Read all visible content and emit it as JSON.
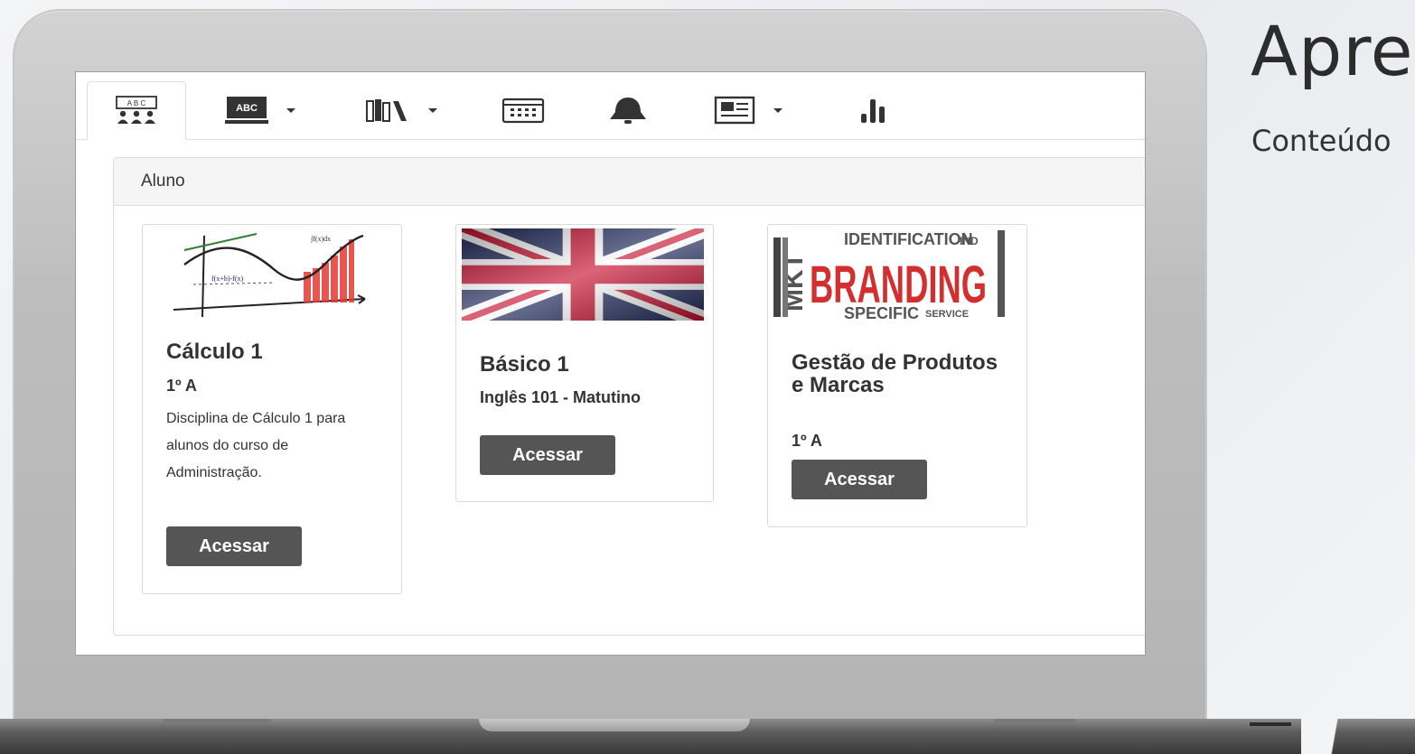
{
  "aside": {
    "title": "Apre",
    "subtitle": "Conteúdo"
  },
  "tabs": [
    {
      "icon": "class-list-icon",
      "active": true
    },
    {
      "icon": "abc-board-icon",
      "dropdown": true
    },
    {
      "icon": "library-icon",
      "dropdown": true
    },
    {
      "icon": "calendar-icon"
    },
    {
      "icon": "bell-icon"
    },
    {
      "icon": "news-icon",
      "dropdown": true
    },
    {
      "icon": "bar-chart-icon"
    }
  ],
  "panel": {
    "title": "Aluno"
  },
  "courses": [
    {
      "title": "Cálculo 1",
      "subtitle": "1º A",
      "description": "Disciplina de Cálculo 1 para alunos do curso de Administração.",
      "button": "Acessar",
      "image": "calculus-graph"
    },
    {
      "title": "Básico 1",
      "subtitle": "Inglês 101 - Matutino",
      "button": "Acessar",
      "image": "uk-flag"
    },
    {
      "title": "Gestão de Produtos e Marcas",
      "subtitle": "1º A",
      "button": "Acessar",
      "image": "branding-wordcloud",
      "image_text": "BRANDING"
    }
  ],
  "colors": {
    "button": "#555555",
    "branding_red": "#d32f2f",
    "flag_blue": "#1f2a5c",
    "flag_red": "#c8102e"
  }
}
